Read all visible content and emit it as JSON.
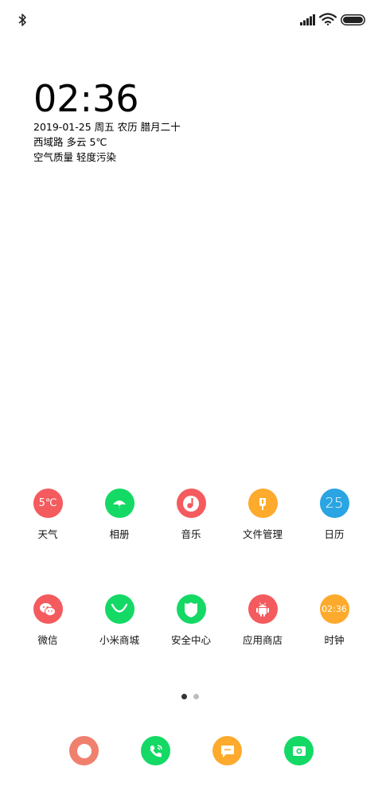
{
  "status_bar": {
    "bluetooth_icon": "bluetooth-icon",
    "signal_icon": "signal-icon",
    "wifi_icon": "wifi-icon",
    "battery_icon": "battery-icon"
  },
  "clock": {
    "time": "02:36",
    "date_line": "2019-01-25 周五 农历 腊月二十",
    "weather_line": "西域路 多云 5℃",
    "air_line": "空气质量 轻度污染"
  },
  "apps_row1": [
    {
      "label": "天气",
      "icon_text": "5℃",
      "color": "#f45b5e"
    },
    {
      "label": "相册",
      "icon": "gallery-icon",
      "color": "#14d965"
    },
    {
      "label": "音乐",
      "icon": "music-icon",
      "color": "#f45b5e"
    },
    {
      "label": "文件管理",
      "icon": "file-manager-icon",
      "color": "#fdaa2d"
    },
    {
      "label": "日历",
      "icon_text": "25",
      "color": "#2aa4e2"
    }
  ],
  "apps_row2": [
    {
      "label": "微信",
      "icon": "wechat-icon",
      "color": "#f45b5e"
    },
    {
      "label": "小米商城",
      "icon": "mi-store-icon",
      "color": "#14d965"
    },
    {
      "label": "安全中心",
      "icon": "security-shield-icon",
      "color": "#14d965"
    },
    {
      "label": "应用商店",
      "icon": "android-icon",
      "color": "#f45b5e"
    },
    {
      "label": "时钟",
      "icon_text": "02:36",
      "color": "#fdaa2d"
    }
  ],
  "page_indicator": {
    "current": 1,
    "total": 2
  },
  "dock": [
    {
      "icon": "browser-icon",
      "color": "#f0806e"
    },
    {
      "icon": "phone-icon",
      "color": "#14d965"
    },
    {
      "icon": "messages-icon",
      "color": "#fdaa2d"
    },
    {
      "icon": "camera-icon",
      "color": "#14d965"
    }
  ]
}
